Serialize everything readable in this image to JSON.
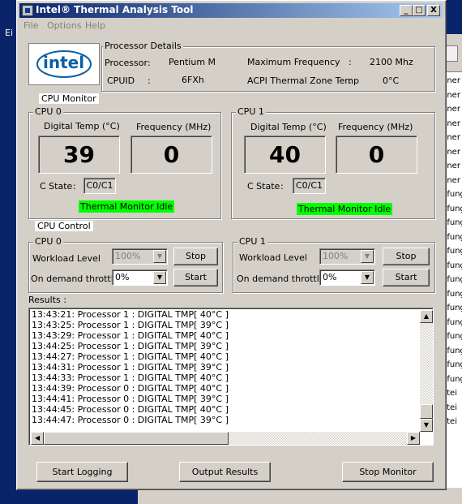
{
  "background": {
    "left_text": "Ei",
    "right_rows": [
      "dner",
      "dner",
      "dner",
      "dner",
      "dner",
      "dner",
      "dner",
      "dner",
      "pfung",
      "pfung",
      "pfung",
      "pfung",
      "pfung",
      "pfung",
      "pfung",
      "pfung",
      "pfung",
      "pfung",
      "pfung",
      "pfung",
      "pfung",
      "pfung",
      "atei",
      "atei",
      "atei"
    ]
  },
  "window": {
    "title": "Intel® Thermal Analysis Tool",
    "menu": [
      "File",
      "Options",
      "Help"
    ],
    "caption_buttons": [
      "_",
      "□",
      "X"
    ]
  },
  "logo": {
    "text": "intel"
  },
  "processor_details": {
    "label": "Processor Details",
    "processor_label": "Processor",
    "processor_sep": ":",
    "processor_value": "Pentium M",
    "cpuid_label": "CPUID",
    "cpuid_sep": ":",
    "cpuid_value": "6FXh",
    "max_freq_label": "Maximum Frequency",
    "max_freq_sep": ":",
    "max_freq_value": "2100 Mhz",
    "acpi_label": "ACPI Thermal Zone Temp",
    "acpi_sep": ":",
    "acpi_value": "0°C"
  },
  "cpu_monitor": {
    "label": "CPU Monitor",
    "cpus": [
      {
        "label": "CPU 0",
        "temp_label": "Digital Temp (°C)",
        "temp_value": "39",
        "freq_label": "Frequency (MHz)",
        "freq_value": "0",
        "cstate_label": "C State",
        "cstate_sep": ":",
        "cstate_value": "C0/C1",
        "status": "Thermal Monitor Idle"
      },
      {
        "label": "CPU 1",
        "temp_label": "Digital Temp (°C)",
        "temp_value": "40",
        "freq_label": "Frequency (MHz)",
        "freq_value": "0",
        "cstate_label": "C State",
        "cstate_sep": ":",
        "cstate_value": "C0/C1",
        "status": "Thermal Monitor Idle"
      }
    ]
  },
  "cpu_control": {
    "label": "CPU Control",
    "cpus": [
      {
        "label": "CPU 0",
        "workload_label": "Workload  Level",
        "workload_value": "100%",
        "throttle_label": "On demand throttle",
        "throttle_value": "0%",
        "stop_label": "Stop",
        "start_label": "Start"
      },
      {
        "label": "CPU 1",
        "workload_label": "Workload  Level",
        "workload_value": "100%",
        "throttle_label": "On demand throttle",
        "throttle_value": "0%",
        "stop_label": "Stop",
        "start_label": "Start"
      }
    ]
  },
  "results": {
    "label": "Results :",
    "lines": [
      "13:43:21: Processor 1 : DIGITAL TMP[ 40°C ]",
      "13:43:25: Processor 1 : DIGITAL TMP[ 39°C ]",
      "13:43:29: Processor 1 : DIGITAL TMP[ 40°C ]",
      "13:44:25: Processor 1 : DIGITAL TMP[ 39°C ]",
      "13:44:27: Processor 1 : DIGITAL TMP[ 40°C ]",
      "13:44:31: Processor 1 : DIGITAL TMP[ 39°C ]",
      "13:44:33: Processor 1 : DIGITAL TMP[ 40°C ]",
      "13:44:39: Processor 0 : DIGITAL TMP[ 40°C ]",
      "13:44:41: Processor 0 : DIGITAL TMP[ 39°C ]",
      "13:44:45: Processor 0 : DIGITAL TMP[ 40°C ]",
      "13:44:47: Processor 0 : DIGITAL TMP[ 39°C ]"
    ]
  },
  "footer": {
    "start_logging": "Start Logging",
    "output_results": "Output Results",
    "stop_monitor": "Stop Monitor"
  },
  "colors": {
    "desktop": "#0a246a",
    "window_face": "#d4d0c8",
    "status_green": "#00ff00",
    "intel_blue": "#0860a8"
  }
}
